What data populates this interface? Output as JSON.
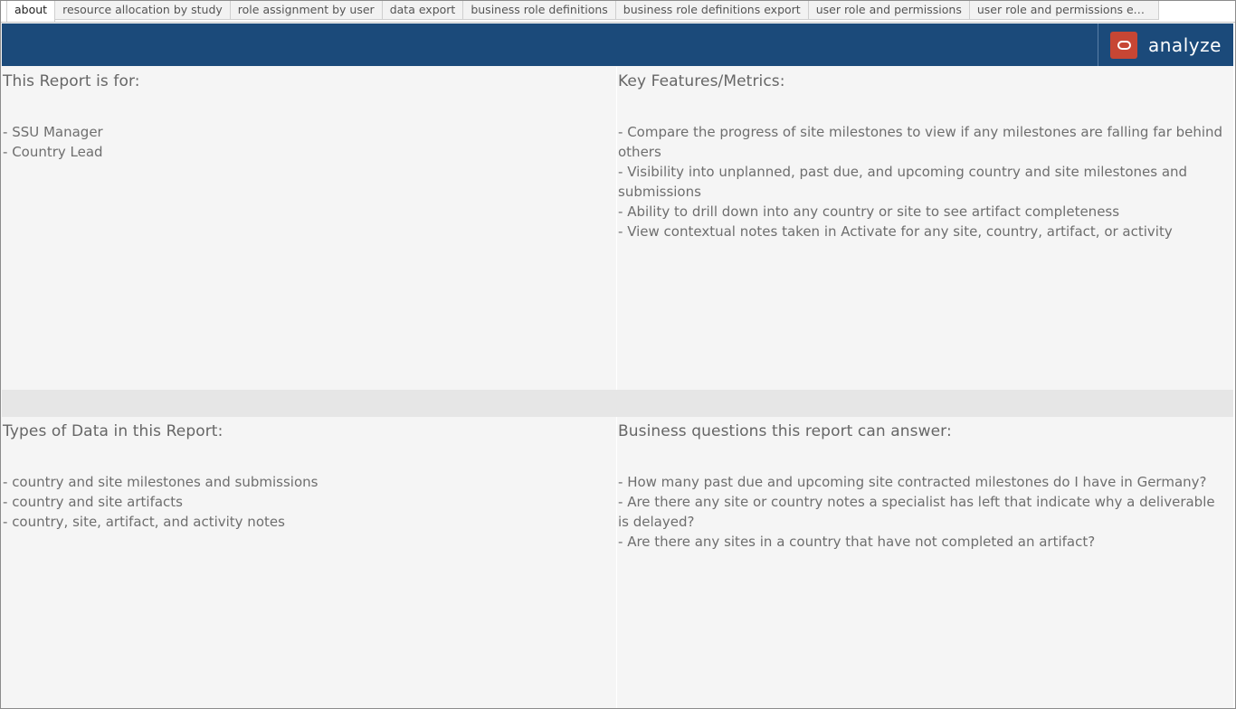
{
  "tabs": [
    {
      "label": "about",
      "active": true
    },
    {
      "label": "resource allocation by study",
      "active": false
    },
    {
      "label": "role assignment by user",
      "active": false
    },
    {
      "label": "data export",
      "active": false
    },
    {
      "label": "business role definitions",
      "active": false
    },
    {
      "label": "business role definitions export",
      "active": false
    },
    {
      "label": "user role and permissions",
      "active": false
    },
    {
      "label": "user role and permissions export",
      "active": false
    }
  ],
  "header": {
    "brand_text": "analyze",
    "brand_icon": "oracle-ring-icon",
    "colors": {
      "header_bg": "#1b4a7a",
      "logo_bg": "#c74634"
    }
  },
  "panels": {
    "report_for": {
      "title": "This Report is for:",
      "items": [
        "SSU Manager",
        "Country Lead"
      ]
    },
    "key_features": {
      "title": "Key Features/Metrics:",
      "items": [
        "Compare the progress of site milestones to view if any milestones are falling far behind others",
        "Visibility into unplanned, past due, and upcoming country and site milestones and submissions",
        "Ability to drill down into any country or site to see artifact completeness",
        "View contextual notes taken in Activate for any site, country, artifact, or activity"
      ]
    },
    "data_types": {
      "title": "Types of Data in this Report:",
      "items": [
        "country and site milestones and submissions",
        "country and site artifacts",
        "country, site, artifact, and activity notes"
      ]
    },
    "business_questions": {
      "title": "Business questions this report can answer:",
      "items": [
        "How many past due and upcoming site contracted milestones do I have in Germany?",
        "Are there any site or country notes a specialist has left that indicate why a deliverable is delayed?",
        "Are there any sites in a country that have not completed an artifact?"
      ]
    }
  }
}
